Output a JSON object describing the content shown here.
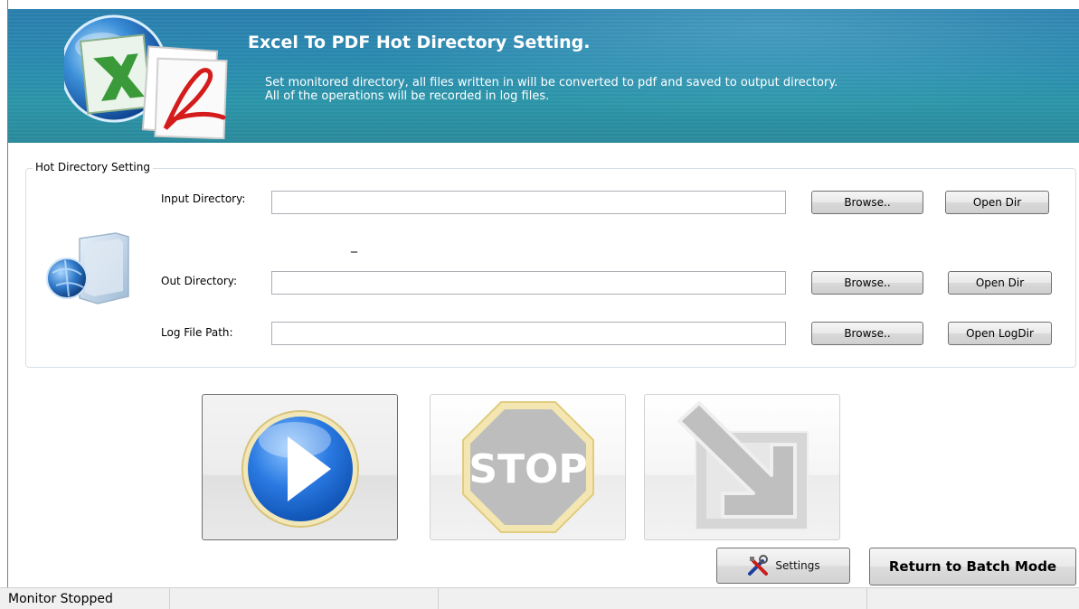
{
  "header": {
    "title": "Excel To PDF Hot Directory Setting.",
    "desc_line1": "Set monitored directory, all files written in will be converted to pdf and saved to output directory.",
    "desc_line2": "All of the operations will be recorded in log files.",
    "icon": "excel-to-pdf-icon"
  },
  "hot_directory": {
    "legend": "Hot Directory Setting",
    "icon": "folder-globe-icon",
    "input_directory": {
      "label": "Input Directory:",
      "value": "",
      "browse": "Browse..",
      "open": "Open Dir"
    },
    "separator": "_",
    "out_directory": {
      "label": "Out Directory:",
      "value": "",
      "browse": "Browse..",
      "open": "Open Dir"
    },
    "log_file_path": {
      "label": "Log File Path:",
      "value": "",
      "browse": "Browse..",
      "open": "Open LogDir"
    }
  },
  "actions": {
    "start_icon": "play-icon",
    "stop_icon": "stop-icon",
    "stop_text": "STOP",
    "minimize_icon": "minimize-to-tray-icon"
  },
  "footer": {
    "settings_label": "Settings",
    "settings_icon": "tools-icon",
    "return_label": "Return to Batch Mode"
  },
  "status": {
    "text": "Monitor Stopped"
  },
  "colors": {
    "header_bg": "#2a8bb0",
    "play_blue": "#1e6fd6",
    "stop_gray": "#bdbdbd"
  }
}
